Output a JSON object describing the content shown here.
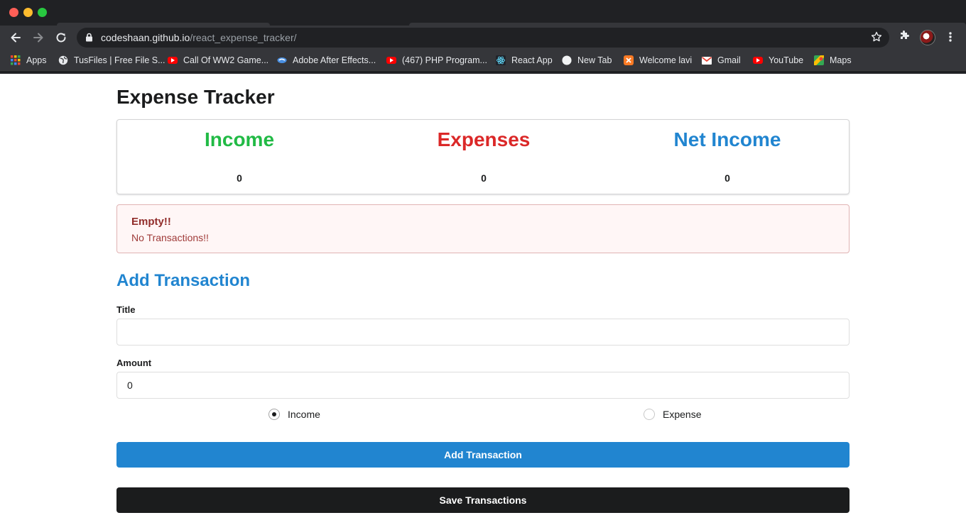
{
  "browser": {
    "url_host": "codeshaan.github.io",
    "url_path": "/react_expense_tracker/",
    "bookmarks": [
      {
        "label": "Apps",
        "icon": "apps-grid-icon"
      },
      {
        "label": "TusFiles | Free File S...",
        "icon": "globe-icon"
      },
      {
        "label": "Call Of WW2 Game...",
        "icon": "youtube-icon"
      },
      {
        "label": "Adobe After Effects...",
        "icon": "bookmark-site-icon"
      },
      {
        "label": "(467) PHP Program...",
        "icon": "youtube-icon"
      },
      {
        "label": "React App",
        "icon": "react-icon"
      },
      {
        "label": "New Tab",
        "icon": "blank-circle-icon"
      },
      {
        "label": "Welcome lavi",
        "icon": "xampp-icon"
      },
      {
        "label": "Gmail",
        "icon": "gmail-icon"
      },
      {
        "label": "YouTube",
        "icon": "youtube-icon"
      },
      {
        "label": "Maps",
        "icon": "maps-icon"
      }
    ]
  },
  "app": {
    "title": "Expense Tracker",
    "stats": {
      "income": {
        "label": "Income",
        "value": "0",
        "color": "#21ba45"
      },
      "expenses": {
        "label": "Expenses",
        "value": "0",
        "color": "#db2828"
      },
      "net": {
        "label": "Net Income",
        "value": "0",
        "color": "#2185d0"
      }
    },
    "alert": {
      "header": "Empty!!",
      "message": "No Transactions!!"
    },
    "form": {
      "heading": "Add Transaction",
      "title_label": "Title",
      "title_value": "",
      "amount_label": "Amount",
      "amount_value": "0",
      "radio_income": "Income",
      "radio_expense": "Expense",
      "selected_type": "Income",
      "add_button": "Add Transaction",
      "save_button": "Save Transactions"
    }
  }
}
